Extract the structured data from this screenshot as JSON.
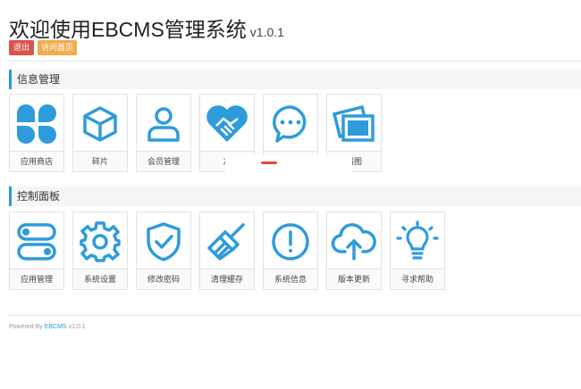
{
  "header": {
    "title": "欢迎使用EBCMS管理系统",
    "version": "v1.0.1",
    "logout_label": "退出",
    "home_label": "访问首页"
  },
  "colors": {
    "accent": "#2e9bdc",
    "danger": "#d9534f",
    "warning": "#f0ad4e"
  },
  "sections": [
    {
      "title": "信息管理",
      "tiles": [
        {
          "label": "应用商店",
          "icon": "clover-icon"
        },
        {
          "label": "碎片",
          "icon": "cube-icon"
        },
        {
          "label": "会员管理",
          "icon": "user-icon"
        },
        {
          "label": "友",
          "icon": "handshake-icon"
        },
        {
          "label": "",
          "icon": "chat-bubble-icon"
        },
        {
          "label": "播图",
          "icon": "photos-icon"
        }
      ]
    },
    {
      "title": "控制面板",
      "tiles": [
        {
          "label": "应用管理",
          "icon": "toggles-icon"
        },
        {
          "label": "系统设置",
          "icon": "gear-icon"
        },
        {
          "label": "修改密码",
          "icon": "shield-check-icon"
        },
        {
          "label": "清理缓存",
          "icon": "broom-icon"
        },
        {
          "label": "系统信息",
          "icon": "info-icon"
        },
        {
          "label": "版本更新",
          "icon": "cloud-upload-icon"
        },
        {
          "label": "寻求帮助",
          "icon": "lightbulb-icon"
        }
      ]
    }
  ],
  "footer": {
    "prefix": "Powered By",
    "link": "EBCMS",
    "version": "v1.0.1"
  }
}
